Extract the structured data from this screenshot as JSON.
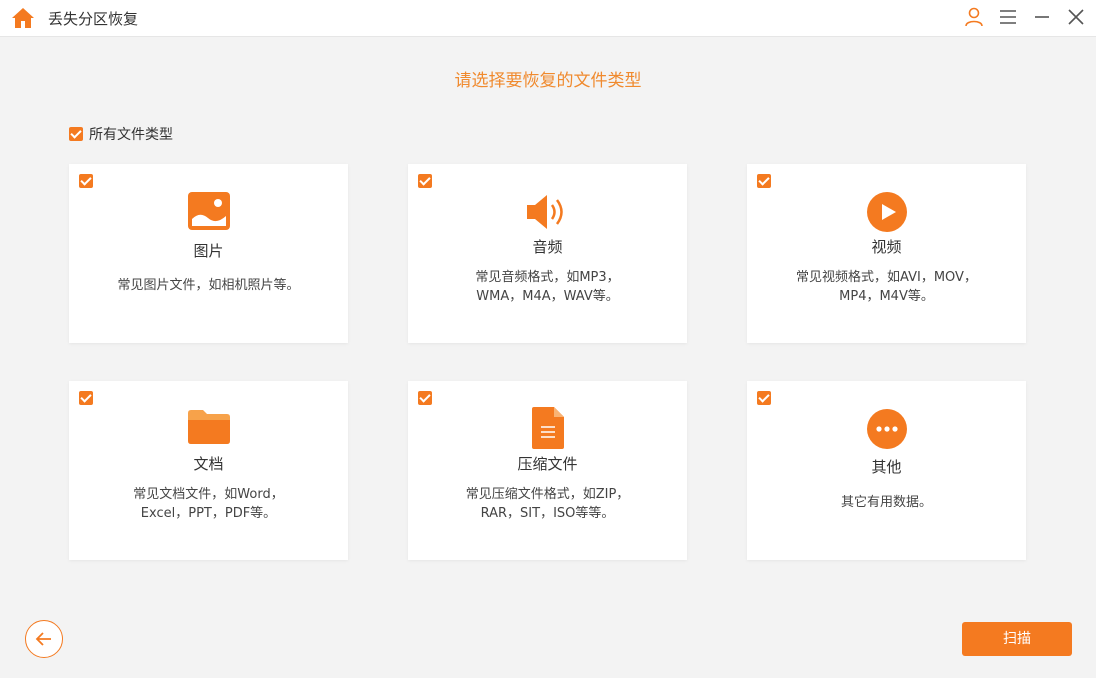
{
  "app": {
    "title": "丢失分区恢复"
  },
  "colors": {
    "accent": "#f47a20",
    "heading": "#f08a2e"
  },
  "header": {
    "heading": "请选择要恢复的文件类型"
  },
  "all_types": {
    "label": "所有文件类型",
    "checked": true
  },
  "cards": [
    {
      "name": "图片",
      "icon": "image-icon",
      "checked": true,
      "desc": [
        "常见图片文件，如相机照片等。"
      ]
    },
    {
      "name": "音频",
      "icon": "speaker-icon",
      "checked": true,
      "desc": [
        "常见音频格式，如MP3，",
        "WMA，M4A，WAV等。"
      ]
    },
    {
      "name": "视频",
      "icon": "play-icon",
      "checked": true,
      "desc": [
        "常见视频格式，如AVI，MOV，",
        "MP4，M4V等。"
      ]
    },
    {
      "name": "文档",
      "icon": "folder-icon",
      "checked": true,
      "desc": [
        "常见文档文件，如Word，",
        "Excel，PPT，PDF等。"
      ]
    },
    {
      "name": "压缩文件",
      "icon": "archive-file-icon",
      "checked": true,
      "desc": [
        "常见压缩文件格式，如ZIP，",
        "RAR，SIT，ISO等等。"
      ]
    },
    {
      "name": "其他",
      "icon": "more-icon",
      "checked": true,
      "desc": [
        "其它有用数据。"
      ]
    }
  ],
  "footer": {
    "scan_label": "扫描"
  }
}
